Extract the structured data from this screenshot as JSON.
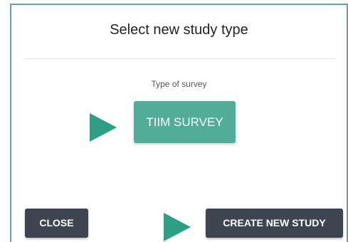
{
  "dialog": {
    "title": "Select new study type",
    "survey_label": "Type of survey",
    "survey_option": "TIIM SURVEY",
    "close_label": "CLOSE",
    "create_label": "CREATE NEW STUDY"
  },
  "colors": {
    "accent": "#52ad98",
    "border": "#5aa897",
    "arrow": "#2e9e84",
    "dark_button": "#3e4550"
  },
  "icons": {
    "pointer_arrow": "play-arrow-icon"
  }
}
